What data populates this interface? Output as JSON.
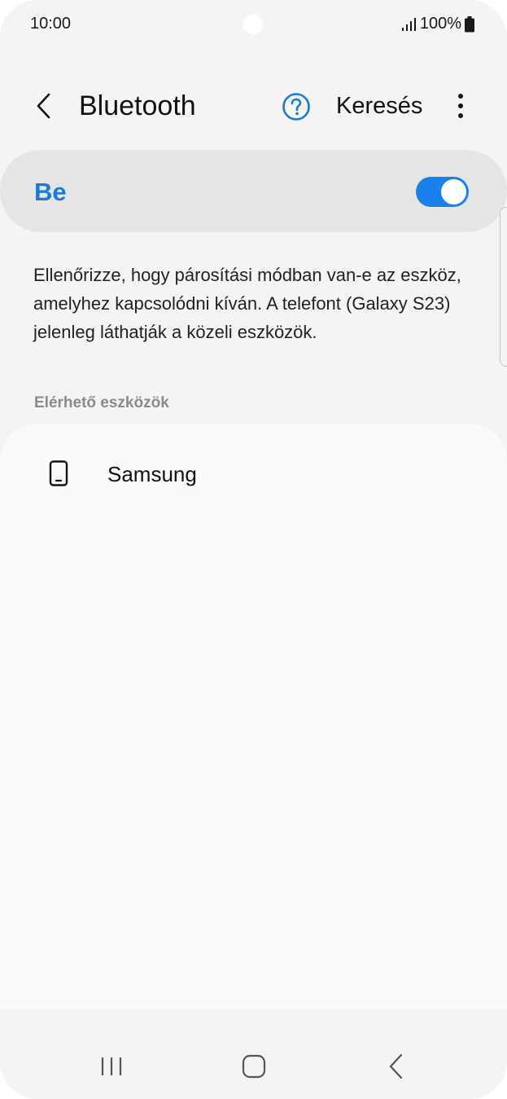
{
  "status_bar": {
    "time": "10:00",
    "battery": "100%",
    "icons": [
      "signal-icon",
      "battery-icon"
    ]
  },
  "header": {
    "title": "Bluetooth",
    "search_label": "Keresés",
    "icons": [
      "back-icon",
      "help-icon",
      "more-icon"
    ]
  },
  "toggle": {
    "label": "Be",
    "state": "on",
    "accent_color": "#1a80ee"
  },
  "description": "Ellenőrizze, hogy párosítási módban van-e az eszköz, amelyhez kapcsolódni kíván. A telefont (Galaxy S23) jelenleg láthatják a közeli eszközök.",
  "available_devices": {
    "header": "Elérhető eszközök",
    "items": [
      {
        "name": "Samsung",
        "icon": "phone-icon"
      }
    ]
  },
  "nav_bar": {
    "icons": [
      "recent-apps-icon",
      "home-icon",
      "back-nav-icon"
    ]
  }
}
